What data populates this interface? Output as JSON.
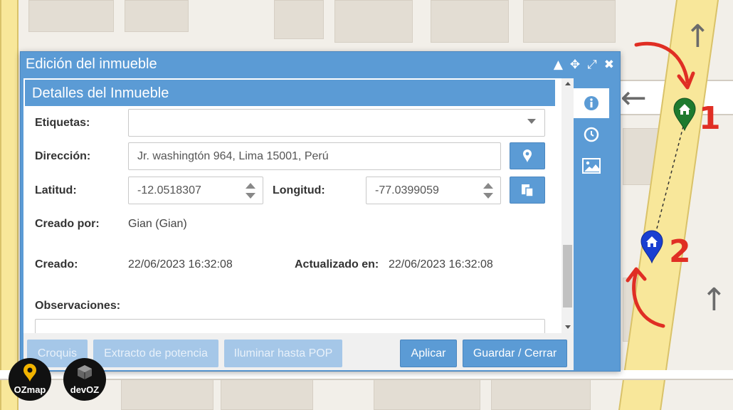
{
  "dialog": {
    "title": "Edición del inmueble",
    "controls": [
      "▲",
      "✥",
      "⤢",
      "✖"
    ]
  },
  "section": {
    "title": "Detalles del Inmueble"
  },
  "form": {
    "etiquetas_label": "Etiquetas:",
    "etiquetas_value": "",
    "direccion_label": "Dirección:",
    "direccion_value": "Jr. washingtón 964, Lima 15001, Perú",
    "latitud_label": "Latitud:",
    "latitud_value": "-12.0518307",
    "longitud_label": "Longitud:",
    "longitud_value": "-77.0399059",
    "creado_por_label": "Creado por:",
    "creado_por_value": "Gian (Gian)",
    "creado_label": "Creado:",
    "creado_value": "22/06/2023 16:32:08",
    "actualizado_label": "Actualizado en:",
    "actualizado_value": "22/06/2023 16:32:08",
    "observaciones_label": "Observaciones:"
  },
  "footer": {
    "croquis": "Croquis",
    "extracto": "Extracto de potencia",
    "iluminar": "Iluminar hasta POP",
    "aplicar": "Aplicar",
    "guardar": "Guardar / Cerrar"
  },
  "side_tabs": [
    "info-icon",
    "clock-icon",
    "image-icon"
  ],
  "map": {
    "marker1_num": "1",
    "marker2_num": "2"
  },
  "logos": {
    "ozmap": "OZmap",
    "devoz": "devOZ"
  },
  "colors": {
    "accent": "#5b9bd5",
    "marker1": "#1e7a2e",
    "marker2": "#1a3fd1",
    "annotation": "#e02e24"
  }
}
